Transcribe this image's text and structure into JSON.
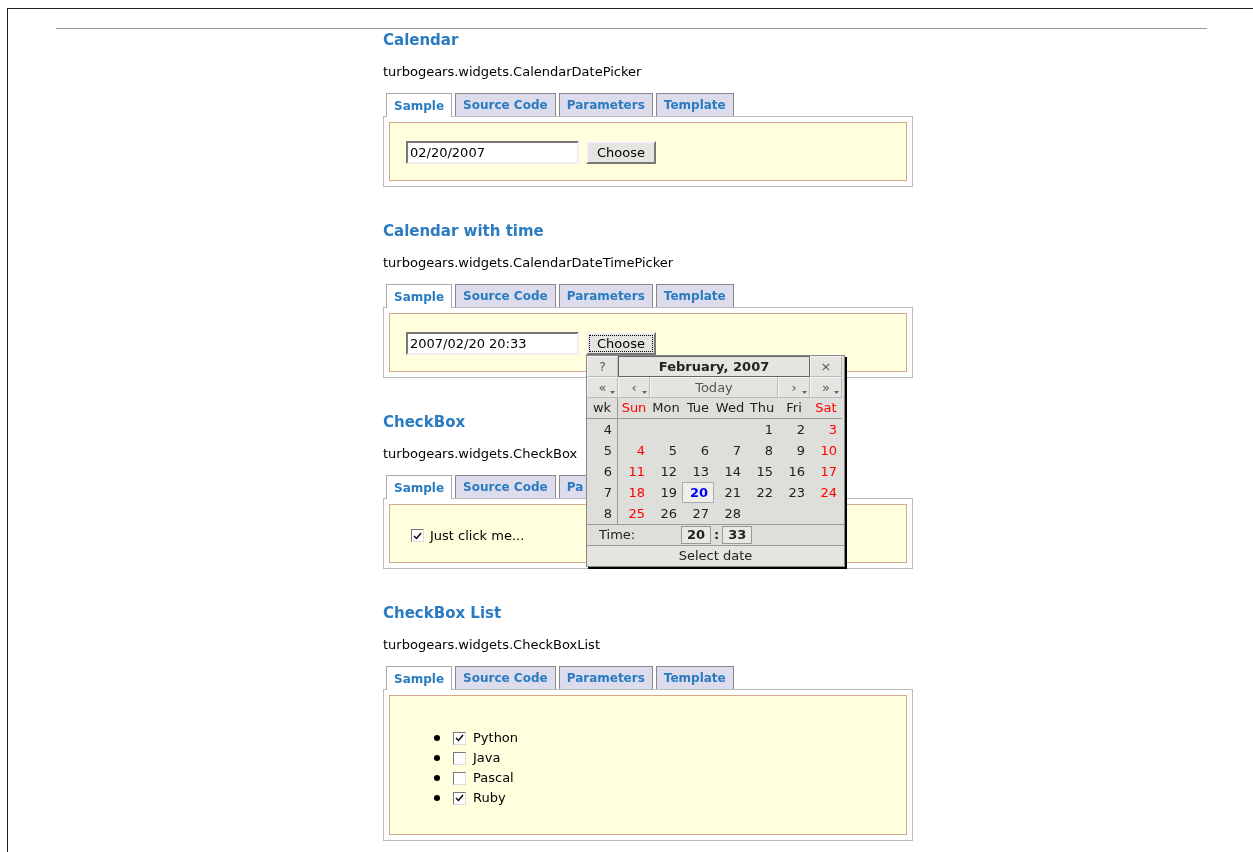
{
  "sections": [
    {
      "title": "Calendar",
      "class_name": "turbogears.widgets.CalendarDatePicker",
      "tabs": [
        {
          "label": "Sample",
          "selected": true
        },
        {
          "label": "Source Code",
          "selected": false
        },
        {
          "label": "Parameters",
          "selected": false
        },
        {
          "label": "Template",
          "selected": false
        }
      ],
      "sample": {
        "kind": "date_picker",
        "value": "02/20/2007",
        "button": "Choose",
        "popup_open": false
      }
    },
    {
      "title": "Calendar with time",
      "class_name": "turbogears.widgets.CalendarDateTimePicker",
      "tabs": [
        {
          "label": "Sample",
          "selected": true
        },
        {
          "label": "Source Code",
          "selected": false
        },
        {
          "label": "Parameters",
          "selected": false
        },
        {
          "label": "Template",
          "selected": false
        }
      ],
      "sample": {
        "kind": "date_picker",
        "value": "2007/02/20 20:33",
        "button": "Choose",
        "popup_open": true
      }
    },
    {
      "title": "CheckBox",
      "class_name": "turbogears.widgets.CheckBox",
      "tabs": [
        {
          "label": "Sample",
          "selected": true
        },
        {
          "label": "Source Code",
          "selected": false
        },
        {
          "label": "Pa",
          "selected": false
        }
      ],
      "sample": {
        "kind": "checkbox",
        "label": "Just click me...",
        "checked": true
      }
    },
    {
      "title": "CheckBox List",
      "class_name": "turbogears.widgets.CheckBoxList",
      "tabs": [
        {
          "label": "Sample",
          "selected": true
        },
        {
          "label": "Source Code",
          "selected": false
        },
        {
          "label": "Parameters",
          "selected": false
        },
        {
          "label": "Template",
          "selected": false
        }
      ],
      "sample": {
        "kind": "checkbox_list",
        "items": [
          {
            "label": "Python",
            "checked": true
          },
          {
            "label": "Java",
            "checked": false
          },
          {
            "label": "Pascal",
            "checked": false
          },
          {
            "label": "Ruby",
            "checked": true
          }
        ]
      }
    }
  ],
  "calendar_popup": {
    "help": "?",
    "title": "February, 2007",
    "close": "×",
    "nav": [
      {
        "label": "«",
        "menu": true
      },
      {
        "label": "‹",
        "menu": true
      },
      {
        "label": "Today",
        "menu": false
      },
      {
        "label": "›",
        "menu": true
      },
      {
        "label": "»",
        "menu": true
      }
    ],
    "week_header": "wk",
    "day_names": [
      {
        "label": "Sun",
        "weekend": true
      },
      {
        "label": "Mon",
        "weekend": false
      },
      {
        "label": "Tue",
        "weekend": false
      },
      {
        "label": "Wed",
        "weekend": false
      },
      {
        "label": "Thu",
        "weekend": false
      },
      {
        "label": "Fri",
        "weekend": false
      },
      {
        "label": "Sat",
        "weekend": true
      }
    ],
    "weeks": [
      {
        "wk": "4",
        "days": [
          {
            "label": "1",
            "weekend": false,
            "selected": false
          },
          {
            "label": "2",
            "weekend": false,
            "selected": false
          },
          {
            "label": "3",
            "weekend": true,
            "selected": false
          }
        ]
      },
      {
        "wk": "5",
        "days": [
          {
            "label": "4",
            "weekend": true,
            "selected": false
          },
          {
            "label": "5",
            "weekend": false,
            "selected": false
          },
          {
            "label": "6",
            "weekend": false,
            "selected": false
          },
          {
            "label": "7",
            "weekend": false,
            "selected": false
          },
          {
            "label": "8",
            "weekend": false,
            "selected": false
          },
          {
            "label": "9",
            "weekend": false,
            "selected": false
          },
          {
            "label": "10",
            "weekend": true,
            "selected": false
          }
        ]
      },
      {
        "wk": "6",
        "days": [
          {
            "label": "11",
            "weekend": true,
            "selected": false
          },
          {
            "label": "12",
            "weekend": false,
            "selected": false
          },
          {
            "label": "13",
            "weekend": false,
            "selected": false
          },
          {
            "label": "14",
            "weekend": false,
            "selected": false
          },
          {
            "label": "15",
            "weekend": false,
            "selected": false
          },
          {
            "label": "16",
            "weekend": false,
            "selected": false
          },
          {
            "label": "17",
            "weekend": true,
            "selected": false
          }
        ]
      },
      {
        "wk": "7",
        "days": [
          {
            "label": "18",
            "weekend": true,
            "selected": false
          },
          {
            "label": "19",
            "weekend": false,
            "selected": false
          },
          {
            "label": "20",
            "weekend": false,
            "selected": true
          },
          {
            "label": "21",
            "weekend": false,
            "selected": false
          },
          {
            "label": "22",
            "weekend": false,
            "selected": false
          },
          {
            "label": "23",
            "weekend": false,
            "selected": false
          },
          {
            "label": "24",
            "weekend": true,
            "selected": false
          }
        ]
      },
      {
        "wk": "8",
        "days": [
          {
            "label": "25",
            "weekend": true,
            "selected": false
          },
          {
            "label": "26",
            "weekend": false,
            "selected": false
          },
          {
            "label": "27",
            "weekend": false,
            "selected": false
          },
          {
            "label": "28",
            "weekend": false,
            "selected": false
          }
        ]
      }
    ],
    "time_label": "Time:",
    "hour": "20",
    "separator": ":",
    "minute": "33",
    "footer": "Select date"
  }
}
